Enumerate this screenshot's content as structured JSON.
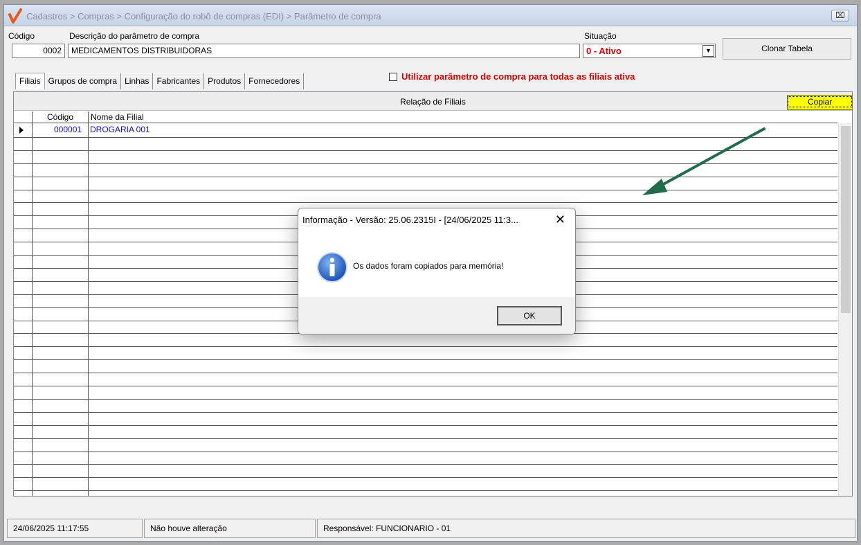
{
  "window": {
    "title": "Cadastros > Compras > Configuração do robô de compras (EDI) > Parâmetro de compra",
    "close_glyph": "⌧"
  },
  "form": {
    "codigo_label": "Código",
    "codigo_value": "0002",
    "descricao_label": "Descrição do parâmetro de compra",
    "descricao_value": "MEDICAMENTOS DISTRIBUIDORAS",
    "situacao_label": "Situação",
    "situacao_value": "0 - Ativo",
    "clonar_label": "Clonar Tabela"
  },
  "tabs": [
    "Filiais",
    "Grupos de compra",
    "Linhas",
    "Fabricantes",
    "Produtos",
    "Fornecedores"
  ],
  "checkbox": {
    "label": "Utilizar parâmetro de compra para todas as filiais ativa",
    "checked": false
  },
  "panel": {
    "title": "Relação de Filiais",
    "copy_label": "Copiar",
    "columns": [
      "Código",
      "Nome da Filial"
    ],
    "rows": [
      {
        "codigo": "000001",
        "nome": "DROGARIA 001"
      }
    ]
  },
  "status": {
    "datetime": "24/06/2025 11:17:55",
    "message": "Não houve alteração",
    "responsavel": "Responsável: FUNCIONARIO - 01"
  },
  "dialog": {
    "title": "Informação - Versão: 25.06.2315I - [24/06/2025 11:3...",
    "close_glyph": "✕",
    "message": "Os dados foram copiados para memória!",
    "ok_label": "OK",
    "icon": "info-icon"
  },
  "colors": {
    "accent_red": "#e00000",
    "link_blue": "#1010d0",
    "copy_yellow": "#ffff00",
    "arrow_green": "#1f6b4a"
  }
}
